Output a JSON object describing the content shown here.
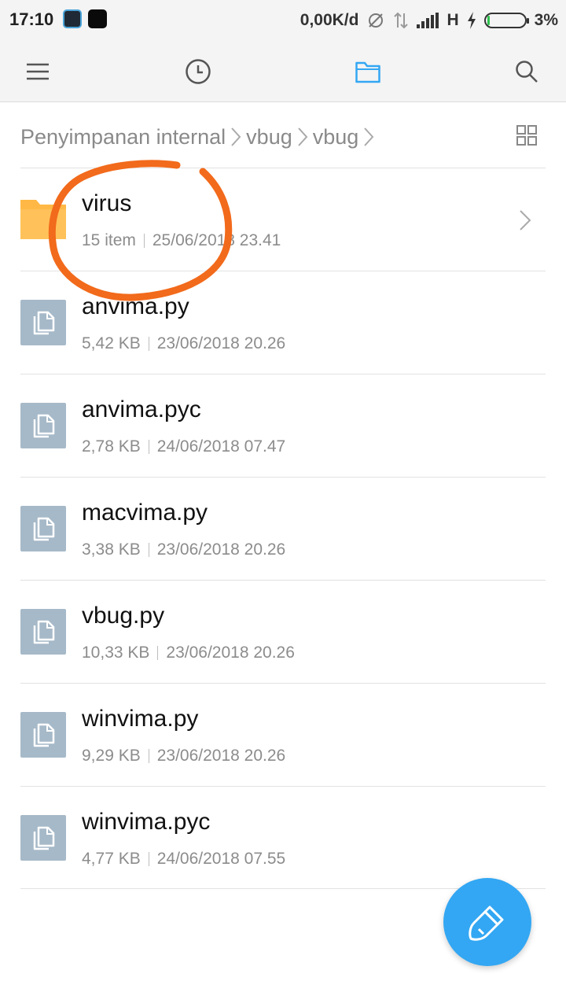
{
  "status_bar": {
    "time": "17:10",
    "network_speed": "0,00K/d",
    "network_type": "H",
    "battery": "3%",
    "battery_level": 0.03
  },
  "toolbar": {
    "icons": [
      "menu-icon",
      "clock-icon",
      "folder-icon",
      "search-icon"
    ],
    "active_color": "#33a7f3"
  },
  "breadcrumb": [
    "Penyimpanan internal",
    "vbug",
    "vbug"
  ],
  "files": [
    {
      "name": "virus",
      "type": "folder",
      "size": "15 item",
      "date": "25/06/2018 23.41"
    },
    {
      "name": "anvima.py",
      "type": "file",
      "size": "5,42 KB",
      "date": "23/06/2018 20.26"
    },
    {
      "name": "anvima.pyc",
      "type": "file",
      "size": "2,78 KB",
      "date": "24/06/2018 07.47"
    },
    {
      "name": "macvima.py",
      "type": "file",
      "size": "3,38 KB",
      "date": "23/06/2018 20.26"
    },
    {
      "name": "vbug.py",
      "type": "file",
      "size": "10,33 KB",
      "date": "23/06/2018 20.26"
    },
    {
      "name": "winvima.py",
      "type": "file",
      "size": "9,29 KB",
      "date": "23/06/2018 20.26"
    },
    {
      "name": "winvima.pyc",
      "type": "file",
      "size": "4,77 KB",
      "date": "24/06/2018 07.55"
    }
  ],
  "colors": {
    "folder": "#ffb845",
    "file_icon": "#a6b9c8",
    "fab": "#33a7f3",
    "annotation": "#f26a1b"
  }
}
